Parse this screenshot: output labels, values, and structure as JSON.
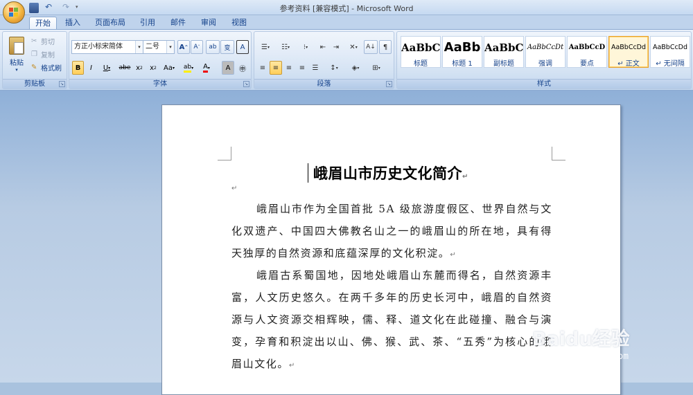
{
  "window": {
    "title": "参考资料 [兼容模式] - Microsoft Word"
  },
  "tabs": [
    "开始",
    "插入",
    "页面布局",
    "引用",
    "邮件",
    "审阅",
    "视图"
  ],
  "clipboard": {
    "paste": "粘贴",
    "cut": "剪切",
    "copy": "复制",
    "format_painter": "格式刷",
    "group_label": "剪贴板"
  },
  "font": {
    "name": "方正小标宋简体",
    "size": "二号",
    "group_label": "字体"
  },
  "paragraph": {
    "group_label": "段落"
  },
  "styles": {
    "group_label": "样式",
    "items": [
      {
        "preview": "AaBbC",
        "name": "标题"
      },
      {
        "preview": "AaBb",
        "name": "标题 1"
      },
      {
        "preview": "AaBbC",
        "name": "副标题"
      },
      {
        "preview": "AaBbCcDt",
        "name": "强调"
      },
      {
        "preview": "AaBbCcD",
        "name": "要点"
      },
      {
        "preview": "AaBbCcDd",
        "name": "↵ 正文"
      },
      {
        "preview": "AaBbCcDd",
        "name": "↵ 无间隔"
      }
    ]
  },
  "document": {
    "title": "峨眉山市历史文化简介",
    "paragraphs": [
      "峨眉山市作为全国首批 5A 级旅游度假区、世界自然与文化双遗产、中国四大佛教名山之一的峨眉山的所在地，具有得天独厚的自然资源和底蕴深厚的文化积淀。",
      "峨眉古系蜀国地，因地处峨眉山东麓而得名，自然资源丰富，人文历史悠久。在两千多年的历史长河中，峨眉的自然资源与人文资源交相辉映，儒、释、道文化在此碰撞、融合与演变，孕育和积淀出以山、佛、猴、武、茶、“五秀”为核心的峨眉山文化。"
    ]
  },
  "watermark": {
    "brand": "Baidu经验",
    "url": "jingyan.baidu.com"
  }
}
